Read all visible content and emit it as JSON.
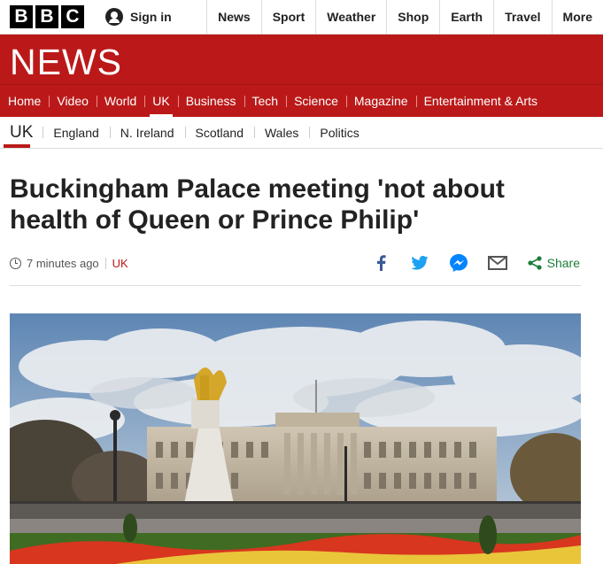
{
  "brand": {
    "letters": [
      "B",
      "B",
      "C"
    ]
  },
  "account": {
    "signin_label": "Sign in"
  },
  "top_nav": [
    "News",
    "Sport",
    "Weather",
    "Shop",
    "Earth",
    "Travel",
    "More"
  ],
  "masthead": {
    "title": "NEWS",
    "color": "#bb1919"
  },
  "sections": [
    "Home",
    "Video",
    "World",
    "UK",
    "Business",
    "Tech",
    "Science",
    "Magazine",
    "Entertainment & Arts"
  ],
  "active_section": "UK",
  "subnav": {
    "home": "UK",
    "items": [
      "England",
      "N. Ireland",
      "Scotland",
      "Wales",
      "Politics"
    ]
  },
  "article": {
    "headline": "Buckingham Palace meeting 'not about health of Queen or Prince Philip'",
    "timestamp": "7 minutes ago",
    "topic": "UK",
    "share_label": "Share",
    "share_icons": [
      "facebook-icon",
      "twitter-icon",
      "messenger-icon",
      "email-icon",
      "share-icon"
    ]
  },
  "colors": {
    "accent": "#bb1919",
    "share_green": "#1a7e3a",
    "facebook": "#3b5998",
    "twitter": "#1da1f2",
    "messenger": "#0084ff"
  }
}
